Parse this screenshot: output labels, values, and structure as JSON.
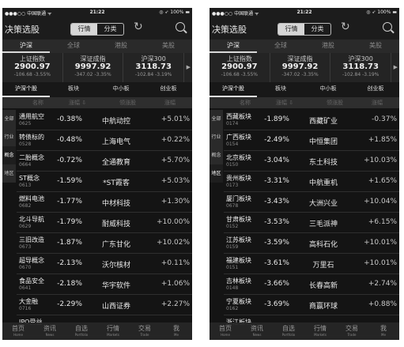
{
  "status": {
    "carrier": "●●●○○ 中国联通 ᯤ",
    "time": "21:22",
    "right": "◎ ➶ 100% ▬"
  },
  "nav": {
    "title": "决策选股",
    "seg": [
      "行情",
      "分类"
    ]
  },
  "markets": [
    "沪深",
    "全球",
    "港股",
    "美股"
  ],
  "indices": [
    {
      "name": "上证指数",
      "value": "2900.97",
      "change": "-106.68",
      "pct": "-3.55%"
    },
    {
      "name": "深证成指",
      "value": "9997.92",
      "change": "-347.02",
      "pct": "-3.35%"
    },
    {
      "name": "沪深300",
      "value": "3118.73",
      "change": "-102.84",
      "pct": "-3.19%"
    }
  ],
  "subtabs": [
    "沪深个股",
    "板块",
    "中小板",
    "创业板"
  ],
  "colhead": {
    "name": "名称",
    "c1": "涨幅 ⇩",
    "c2": "领涨股",
    "c3": "涨幅"
  },
  "side": [
    "全部",
    "行业",
    "概念",
    "地区"
  ],
  "left_rows": [
    {
      "name": "通用航空",
      "code": "0625",
      "pct": "-0.38%",
      "leader": "中航动控",
      "lpct": "+5.01%"
    },
    {
      "name": "转债标的",
      "code": "0528",
      "pct": "-0.48%",
      "leader": "上海电气",
      "lpct": "+0.22%"
    },
    {
      "name": "二胎概念",
      "code": "0664",
      "pct": "-0.72%",
      "leader": "全通教育",
      "lpct": "+5.70%"
    },
    {
      "name": "ST概念",
      "code": "0613",
      "pct": "-1.59%",
      "leader": "*ST霞客",
      "lpct": "+5.03%"
    },
    {
      "name": "燃料电池",
      "code": "0682",
      "pct": "-1.77%",
      "leader": "中材科技",
      "lpct": "+1.30%"
    },
    {
      "name": "北斗导航",
      "code": "0629",
      "pct": "-1.79%",
      "leader": "耐威科技",
      "lpct": "+10.00%"
    },
    {
      "name": "三旧改造",
      "code": "0673",
      "pct": "-1.87%",
      "leader": "广东甘化",
      "lpct": "+10.02%"
    },
    {
      "name": "超导概念",
      "code": "0670",
      "pct": "-2.13%",
      "leader": "沃尔核材",
      "lpct": "+0.11%"
    },
    {
      "name": "食品安全",
      "code": "0641",
      "pct": "-2.18%",
      "leader": "华宇软件",
      "lpct": "+1.06%"
    },
    {
      "name": "大金融",
      "code": "0716",
      "pct": "-2.29%",
      "leader": "山西证券",
      "lpct": "+2.27%"
    },
    {
      "name": "IPO受益",
      "code": "",
      "pct": "",
      "leader": "",
      "lpct": ""
    }
  ],
  "right_rows": [
    {
      "name": "西藏板块",
      "code": "0174",
      "pct": "-1.89%",
      "leader": "西藏矿业",
      "lpct": "-0.37%"
    },
    {
      "name": "广西板块",
      "code": "0154",
      "pct": "-2.49%",
      "leader": "中恒集团",
      "lpct": "+1.85%"
    },
    {
      "name": "北京板块",
      "code": "0150",
      "pct": "-3.04%",
      "leader": "东土科技",
      "lpct": "+10.03%"
    },
    {
      "name": "贵州板块",
      "code": "0173",
      "pct": "-3.31%",
      "leader": "中航重机",
      "lpct": "+1.65%"
    },
    {
      "name": "厦门板块",
      "code": "0678",
      "pct": "-3.43%",
      "leader": "大洲兴业",
      "lpct": "+10.04%"
    },
    {
      "name": "甘肃板块",
      "code": "0152",
      "pct": "-3.53%",
      "leader": "三毛派神",
      "lpct": "+6.15%"
    },
    {
      "name": "江苏板块",
      "code": "0159",
      "pct": "-3.59%",
      "leader": "高科石化",
      "lpct": "+10.01%"
    },
    {
      "name": "福建板块",
      "code": "0151",
      "pct": "-3.61%",
      "leader": "万里石",
      "lpct": "+10.01%"
    },
    {
      "name": "吉林板块",
      "code": "0148",
      "pct": "-3.66%",
      "leader": "长春高新",
      "lpct": "+2.74%"
    },
    {
      "name": "宁夏板块",
      "code": "0162",
      "pct": "-3.69%",
      "leader": "商赢环球",
      "lpct": "+0.88%"
    },
    {
      "name": "浙江板块",
      "code": "",
      "pct": "",
      "leader": "",
      "lpct": ""
    }
  ],
  "bottom": [
    {
      "label": "首页",
      "sub": "Home"
    },
    {
      "label": "资讯",
      "sub": "News"
    },
    {
      "label": "自选",
      "sub": "Portfolio"
    },
    {
      "label": "行情",
      "sub": "Markets"
    },
    {
      "label": "交易",
      "sub": "Trade"
    },
    {
      "label": "我",
      "sub": "Me"
    }
  ]
}
